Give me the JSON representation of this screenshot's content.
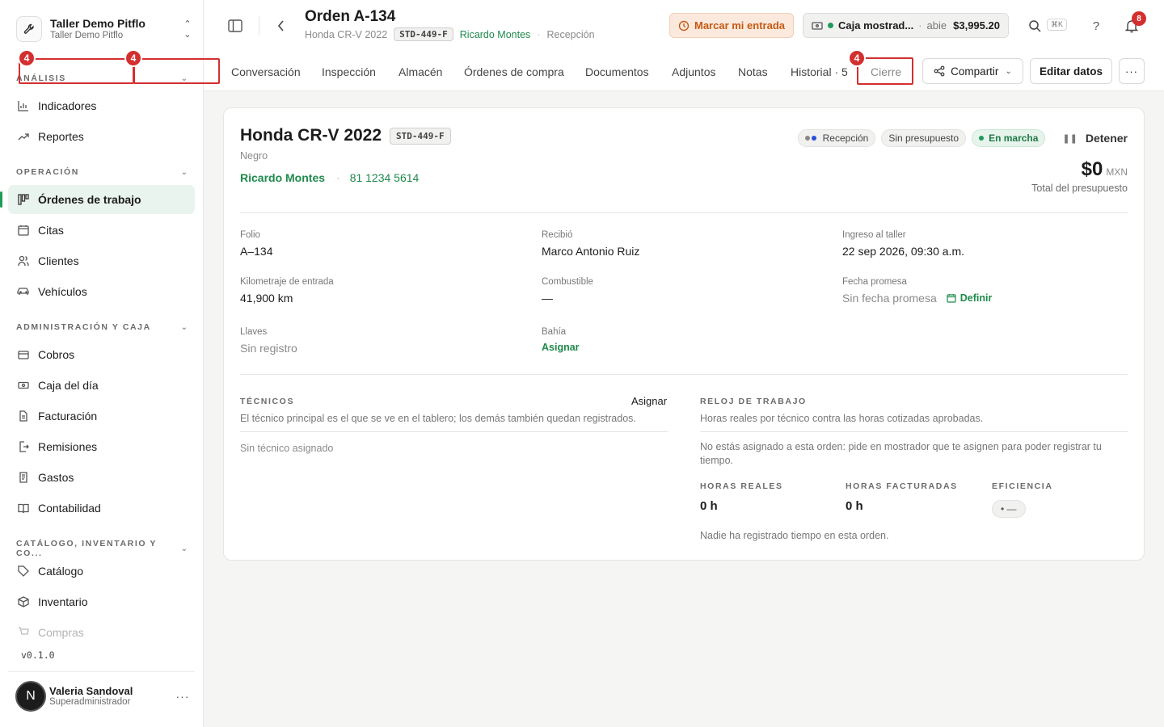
{
  "workspace": {
    "name": "Taller Demo Pitflo",
    "subtitle": "Taller Demo Pitflo"
  },
  "sidebar": {
    "sections": [
      {
        "label": "Análisis",
        "items": [
          {
            "label": "Indicadores",
            "icon": "bar-chart-icon"
          },
          {
            "label": "Reportes",
            "icon": "trending-up-icon"
          }
        ]
      },
      {
        "label": "Operación",
        "items": [
          {
            "label": "Órdenes de trabajo",
            "icon": "kanban-icon",
            "active": true
          },
          {
            "label": "Citas",
            "icon": "calendar-icon"
          },
          {
            "label": "Clientes",
            "icon": "users-icon"
          },
          {
            "label": "Vehículos",
            "icon": "car-icon"
          }
        ]
      },
      {
        "label": "Administración y caja",
        "items": [
          {
            "label": "Cobros",
            "icon": "wallet-icon"
          },
          {
            "label": "Caja del día",
            "icon": "cash-icon"
          },
          {
            "label": "Facturación",
            "icon": "file-icon"
          },
          {
            "label": "Remisiones",
            "icon": "file-export-icon"
          },
          {
            "label": "Gastos",
            "icon": "receipt-icon"
          },
          {
            "label": "Contabilidad",
            "icon": "book-icon"
          }
        ]
      },
      {
        "label": "Catálogo, inventario y co...",
        "items": [
          {
            "label": "Catálogo",
            "icon": "tag-icon"
          },
          {
            "label": "Inventario",
            "icon": "box-icon"
          },
          {
            "label": "Compras",
            "icon": "cart-icon"
          }
        ]
      }
    ],
    "version": "v0.1.0",
    "user": {
      "initial": "N",
      "name": "Valeria Sandoval",
      "role": "Superadministrador"
    }
  },
  "header": {
    "title": "Orden A-134",
    "vehicle": "Honda CR-V 2022",
    "plate": "STD-449-F",
    "customer": "Ricardo Montes",
    "stage": "Recepción",
    "checkin_label": "Marcar mi entrada",
    "register": {
      "name": "Caja mostrad...",
      "status": "abie",
      "amount": "$3,995.20"
    },
    "search_shortcut": "⌘K",
    "help": "?",
    "notifications_count": "8"
  },
  "tabs": [
    "Conversación",
    "Inspección",
    "Almacén",
    "Órdenes de compra",
    "Documentos",
    "Adjuntos",
    "Notas",
    "Historial · 5",
    "Cierre"
  ],
  "actions": {
    "share": "Compartir",
    "edit": "Editar datos",
    "more": "···"
  },
  "annotations": [
    "4",
    "4",
    "4"
  ],
  "card": {
    "title": "Honda CR-V 2022",
    "plate": "STD-449-F",
    "color": "Negro",
    "customer": "Ricardo Montes",
    "phone": "81 1234 5614",
    "pills": {
      "stage": "Recepción",
      "budget": "Sin presupuesto",
      "status": "En marcha"
    },
    "stop_label": "Detener",
    "total": {
      "amount": "$0",
      "currency": "MXN",
      "label": "Total del presupuesto"
    },
    "fields": {
      "folio": {
        "label": "Folio",
        "value": "A–134"
      },
      "received_by": {
        "label": "Recibió",
        "value": "Marco Antonio Ruiz"
      },
      "entry": {
        "label": "Ingreso al taller",
        "value": "22 sep 2026, 09:30 a.m."
      },
      "mileage": {
        "label": "Kilometraje de entrada",
        "value": "41,900 km"
      },
      "fuel": {
        "label": "Combustible",
        "value": "—"
      },
      "promise": {
        "label": "Fecha promesa",
        "value": "Sin fecha promesa",
        "action": "Definir"
      },
      "keys": {
        "label": "Llaves",
        "value": "Sin registro"
      },
      "bay": {
        "label": "Bahía",
        "value": "Asignar"
      }
    },
    "technicians": {
      "heading": "Técnicos",
      "assign": "Asignar",
      "description": "El técnico principal es el que se ve en el tablero; los demás también quedan registrados.",
      "empty": "Sin técnico asignado"
    },
    "clock": {
      "heading": "Reloj de trabajo",
      "description": "Horas reales por técnico contra las horas cotizadas aprobadas.",
      "notice": "No estás asignado a esta orden: pide en mostrador que te asignen para poder registrar tu tiempo.",
      "real_label": "Horas reales",
      "real_value": "0 h",
      "billed_label": "Horas facturadas",
      "billed_value": "0 h",
      "efficiency_label": "Eficiencia",
      "efficiency_value": "• —",
      "footer": "Nadie ha registrado tiempo en esta orden."
    }
  },
  "colors": {
    "accent": "#1f9a5a",
    "annotation": "#d42f2f",
    "checkin": "#c45a14"
  }
}
